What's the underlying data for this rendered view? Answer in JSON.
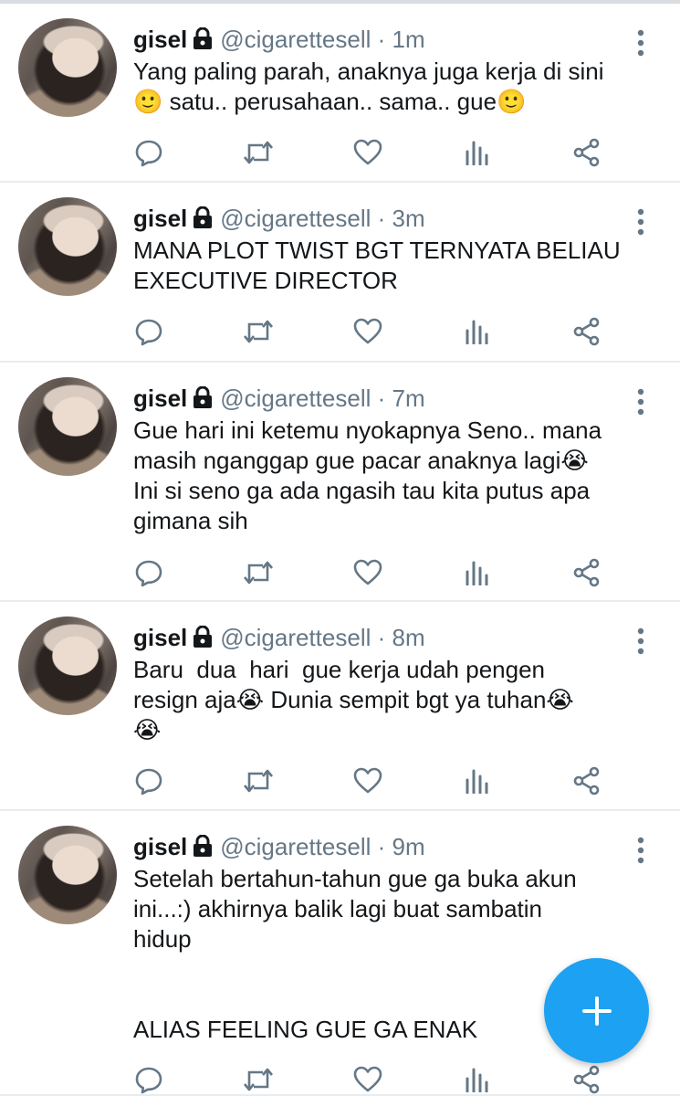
{
  "tweets": [
    {
      "name": "gisel",
      "handle": "@cigarettesell",
      "separator": "·",
      "time": "1m",
      "lines": [
        "Yang paling parah, anaknya juga kerja di sini",
        "🙂 satu.. perusahaan.. sama.. gue🙂"
      ]
    },
    {
      "name": "gisel",
      "handle": "@cigarettesell",
      "separator": "·",
      "time": "3m",
      "lines": [
        "MANA PLOT TWIST BGT TERNYATA BELIAU",
        "EXECUTIVE DIRECTOR"
      ]
    },
    {
      "name": "gisel",
      "handle": "@cigarettesell",
      "separator": "·",
      "time": "7m",
      "lines": [
        "Gue hari ini ketemu nyokapnya Seno.. mana",
        "masih nganggap gue pacar anaknya lagi😭",
        "Ini si seno ga ada ngasih tau kita putus apa",
        "gimana sih"
      ]
    },
    {
      "name": "gisel",
      "handle": "@cigarettesell",
      "separator": "·",
      "time": "8m",
      "lines": [
        "Baru  dua  hari  gue kerja udah pengen",
        "resign aja😭 Dunia sempit bgt ya tuhan😭",
        "😭"
      ]
    },
    {
      "name": "gisel",
      "handle": "@cigarettesell",
      "separator": "·",
      "time": "9m",
      "lines": [
        "Setelah bertahun-tahun gue ga buka akun",
        "ini...:) akhirnya balik lagi buat sambatin",
        "hidup",
        "",
        "",
        "ALIAS FEELING GUE GA ENAK"
      ]
    }
  ],
  "icons": {
    "lock": "lock-icon",
    "more": "more-vertical-icon",
    "reply": "reply-icon",
    "retweet": "retweet-icon",
    "like": "heart-icon",
    "analytics": "analytics-icon",
    "share": "share-icon",
    "compose": "plus-icon"
  },
  "colors": {
    "accent": "#1da1f2",
    "muted": "#657786",
    "text": "#14171a",
    "divider": "#e6ecf0"
  }
}
